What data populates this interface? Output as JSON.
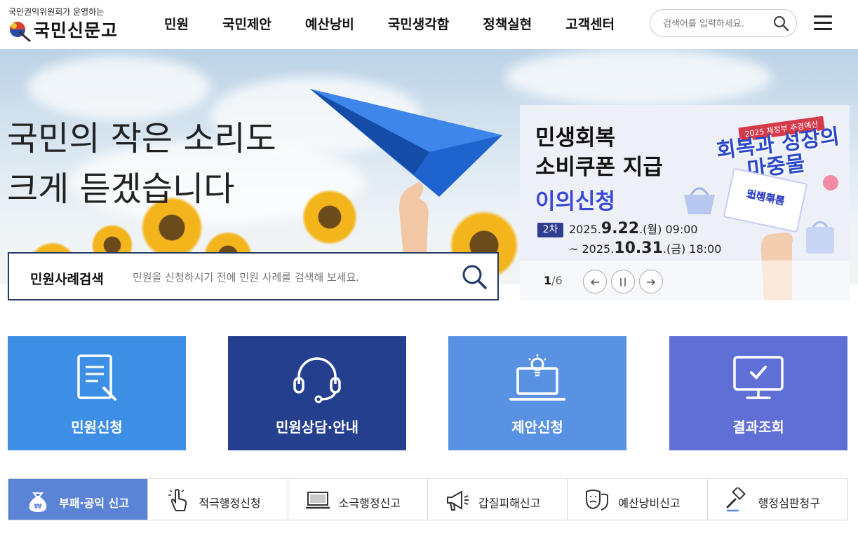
{
  "header": {
    "logo_sub": "국민권익위원회가 운영하는",
    "logo_name": "국민신문고",
    "nav": [
      "민원",
      "국민제안",
      "예산낭비",
      "국민생각함",
      "정책실현",
      "고객센터"
    ],
    "search_placeholder": "검색어를 입력하세요."
  },
  "hero": {
    "title_line1": "국민의 작은 소리도",
    "title_line2": "크게 듣겠습니다",
    "case_search_label": "민원사례검색",
    "case_search_placeholder": "민원을 신청하시기 전에 민원 사례를 검색해 보세요."
  },
  "banner": {
    "line1": "민생회복",
    "line2": "소비쿠폰 지급",
    "line3": "이의신청",
    "badge": "2차",
    "date1_pre": "2025.",
    "date1_big": "9.22",
    "date1_post": ".(월) 09:00",
    "date2_pre": "~ 2025.",
    "date2_big": "10.31",
    "date2_post": ".(금) 18:00",
    "art_tag": "2025 재정부 추경예산",
    "art_title1": "회복과 성장의",
    "art_title2": "마중물",
    "coupon_line1": "민생회복",
    "coupon_line2": "소비쿠폰",
    "pager_current": "1",
    "pager_total": "/6"
  },
  "tiles": [
    {
      "label": "민원신청",
      "color": "#3d8fe6"
    },
    {
      "label": "민원상담·안내",
      "color": "#253f8f"
    },
    {
      "label": "제안신청",
      "color": "#5a92e3"
    },
    {
      "label": "결과조회",
      "color": "#5f6fd6"
    }
  ],
  "reports": [
    {
      "label": "부패·공익 신고",
      "active": true
    },
    {
      "label": "적극행정신청",
      "active": false
    },
    {
      "label": "소극행정신고",
      "active": false
    },
    {
      "label": "갑질피해신고",
      "active": false
    },
    {
      "label": "예산낭비신고",
      "active": false
    },
    {
      "label": "행정심판청구",
      "active": false
    }
  ]
}
